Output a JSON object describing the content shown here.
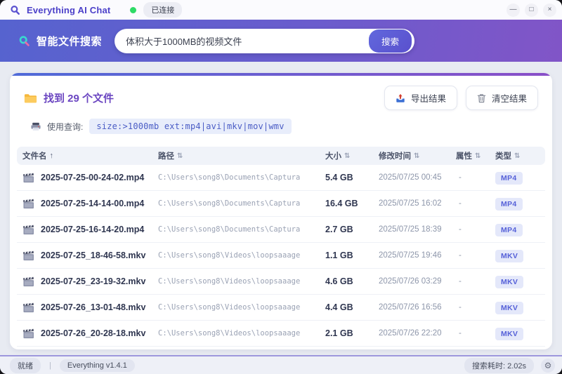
{
  "titlebar": {
    "app_title": "Everything AI Chat",
    "connection_status": "已连接"
  },
  "search": {
    "label": "智能文件搜索",
    "input_value": "体积大于1000MB的视频文件",
    "button_label": "搜索"
  },
  "results": {
    "found_text": "找到 29 个文件",
    "export_label": "导出结果",
    "clear_label": "清空结果",
    "query_label": "使用查询:",
    "query_code": "size:>1000mb ext:mp4|avi|mkv|mov|wmv"
  },
  "table": {
    "headers": [
      "文件名",
      "路径",
      "大小",
      "修改时间",
      "属性",
      "类型"
    ],
    "rows": [
      {
        "name": "2025-07-25-00-24-02.mp4",
        "path": "C:\\Users\\song8\\Documents\\Captura",
        "size": "5.4 GB",
        "modified": "2025/07/25 00:45",
        "attr": "-",
        "type": "MP4"
      },
      {
        "name": "2025-07-25-14-14-00.mp4",
        "path": "C:\\Users\\song8\\Documents\\Captura",
        "size": "16.4 GB",
        "modified": "2025/07/25 16:02",
        "attr": "-",
        "type": "MP4"
      },
      {
        "name": "2025-07-25-16-14-20.mp4",
        "path": "C:\\Users\\song8\\Documents\\Captura",
        "size": "2.7 GB",
        "modified": "2025/07/25 18:39",
        "attr": "-",
        "type": "MP4"
      },
      {
        "name": "2025-07-25_18-46-58.mkv",
        "path": "C:\\Users\\song8\\Videos\\loopsaaage",
        "size": "1.1 GB",
        "modified": "2025/07/25 19:46",
        "attr": "-",
        "type": "MKV"
      },
      {
        "name": "2025-07-25_23-19-32.mkv",
        "path": "C:\\Users\\song8\\Videos\\loopsaaage",
        "size": "4.6 GB",
        "modified": "2025/07/26 03:29",
        "attr": "-",
        "type": "MKV"
      },
      {
        "name": "2025-07-26_13-01-48.mkv",
        "path": "C:\\Users\\song8\\Videos\\loopsaaage",
        "size": "4.4 GB",
        "modified": "2025/07/26 16:56",
        "attr": "-",
        "type": "MKV"
      },
      {
        "name": "2025-07-26_20-28-18.mkv",
        "path": "C:\\Users\\song8\\Videos\\loopsaaage",
        "size": "2.1 GB",
        "modified": "2025/07/26 22:20",
        "attr": "-",
        "type": "MKV"
      }
    ]
  },
  "statusbar": {
    "ready": "就绪",
    "version": "Everything v1.4.1",
    "elapsed": "搜索耗时: 2.02s"
  },
  "icons": {
    "minimize": "—",
    "maximize": "□",
    "close": "×",
    "sort_asc": "↑",
    "sort_both": "⇅",
    "gear": "⚙",
    "separator": "|"
  },
  "colors": {
    "accent": "#5b5fd6",
    "header_gradient_start": "#5663cf",
    "header_gradient_end": "#8155c7",
    "connected_dot": "#2edb66",
    "badge_bg": "#e4e8fa",
    "badge_text": "#5560d8"
  }
}
